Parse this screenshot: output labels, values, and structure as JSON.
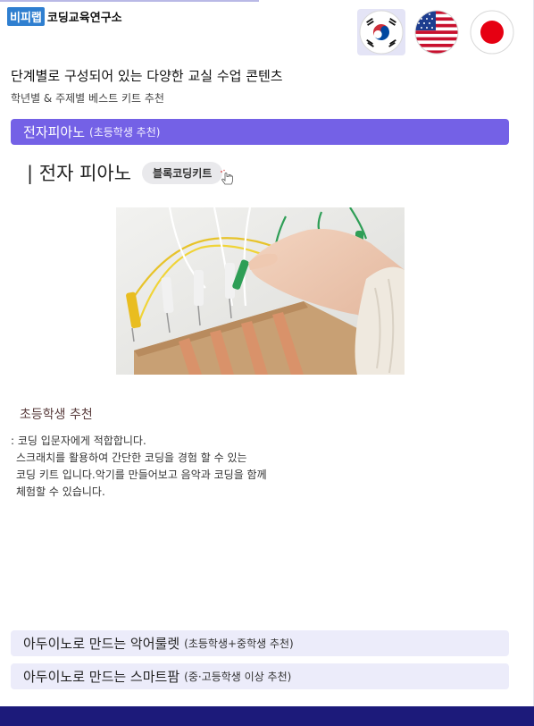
{
  "brand": {
    "mark": "비피랩",
    "name": "코딩교육연구소"
  },
  "languages": [
    {
      "name": "korean-flag-icon",
      "active": true
    },
    {
      "name": "usa-flag-icon",
      "active": false
    },
    {
      "name": "japan-flag-icon",
      "active": false
    }
  ],
  "intro": {
    "title": "단계별로 구성되어 있는 다양한 교실 수업 콘텐츠",
    "subtitle": "학년별 & 주제별 베스트 키트 추천"
  },
  "sections": [
    {
      "title": "전자피아노",
      "note": "(초등학생 추천)"
    },
    {
      "title": "아두이노로 만드는 악어룰렛",
      "note": "(초등학생+중학생 추천)"
    },
    {
      "title": "아두이노로 만드는 스마트팜",
      "note": "(중·고등학생 이상 추천)"
    }
  ],
  "product": {
    "title": "| 전자 피아노",
    "tag": "블록코딩키트",
    "recommend_title": "초등학생 추천",
    "description": [
      ": 코딩 입문자에게 적합합니다.",
      "  스크래치를 활용하여 간단한 코딩을 경험 할 수 있는",
      "  코딩 키트 입니다.악기를 만들어보고 음악과 코딩을 함께",
      "  체험할 수 있습니다."
    ]
  },
  "colors": {
    "active_bar": "#7461e6",
    "inactive_bar": "#ececfa",
    "footer": "#1c1a7a",
    "recommend_title": "#5a3d3d"
  }
}
